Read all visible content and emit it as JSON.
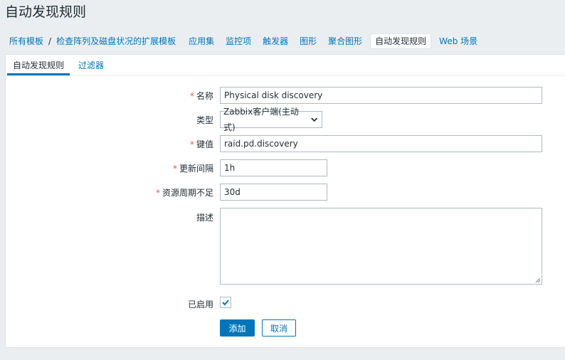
{
  "page": {
    "title": "自动发现规则"
  },
  "nav": {
    "items": [
      {
        "label": "所有模板",
        "active": false
      },
      {
        "label": "检查阵列及磁盘状况的扩展模板",
        "active": false
      },
      {
        "label": "应用集",
        "active": false
      },
      {
        "label": "监控项",
        "active": false
      },
      {
        "label": "触发器",
        "active": false
      },
      {
        "label": "图形",
        "active": false
      },
      {
        "label": "聚合图形",
        "active": false
      },
      {
        "label": "自动发现规则",
        "active": true
      },
      {
        "label": "Web 场景",
        "active": false
      }
    ],
    "separator": "/"
  },
  "tabs": [
    {
      "label": "自动发现规则",
      "active": true
    },
    {
      "label": "过滤器",
      "active": false
    }
  ],
  "form": {
    "required_marker": "*",
    "name": {
      "label": "名称",
      "value": "Physical disk discovery"
    },
    "type": {
      "label": "类型",
      "value": "Zabbix客户端(主动式)"
    },
    "key": {
      "label": "键值",
      "value": "raid.pd.discovery"
    },
    "update_interval": {
      "label": "更新间隔",
      "value": "1h"
    },
    "keep_lost": {
      "label": "资源周期不足",
      "value": "30d"
    },
    "description": {
      "label": "描述",
      "value": ""
    },
    "enabled": {
      "label": "已启用",
      "checked": true
    }
  },
  "buttons": {
    "add": "添加",
    "cancel": "取消"
  },
  "colors": {
    "accent": "#0275b8",
    "required": "#e45959",
    "background": "#ebeef0"
  }
}
